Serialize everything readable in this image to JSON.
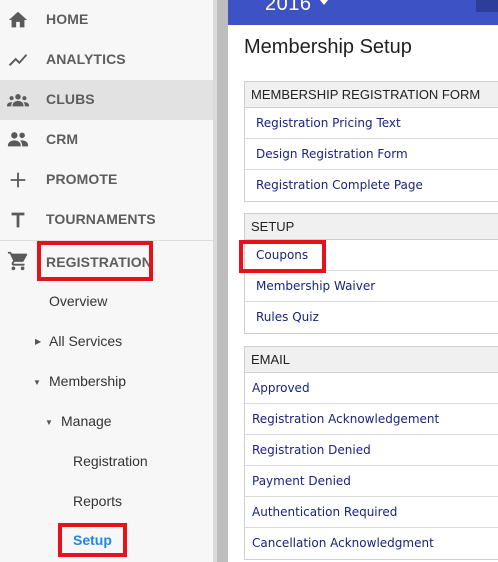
{
  "sidebar": {
    "items": [
      {
        "label": "HOME",
        "icon": "home-icon"
      },
      {
        "label": "ANALYTICS",
        "icon": "trending-line-icon"
      },
      {
        "label": "CLUBS",
        "icon": "group-icon"
      },
      {
        "label": "CRM",
        "icon": "people-icon"
      },
      {
        "label": "PROMOTE",
        "icon": "plus-icon"
      },
      {
        "label": "TOURNAMENTS",
        "icon": "letter-t-icon"
      },
      {
        "label": "REGISTRATION",
        "icon": "cart-icon"
      }
    ],
    "sub": {
      "overview": "Overview",
      "all_services": "All Services",
      "membership": "Membership",
      "manage": "Manage",
      "registration": "Registration",
      "reports": "Reports",
      "setup": "Setup"
    }
  },
  "topbar": {
    "year": "2016"
  },
  "page": {
    "title": "Membership Setup"
  },
  "sections": {
    "form": {
      "header": "MEMBERSHIP REGISTRATION FORM",
      "rows": [
        "Registration Pricing Text",
        "Design Registration Form",
        "Registration Complete Page"
      ]
    },
    "setup": {
      "header": "SETUP",
      "rows": [
        "Coupons",
        "Membership Waiver",
        "Rules Quiz"
      ]
    },
    "email": {
      "header": "EMAIL",
      "rows": [
        "Approved",
        "Registration Acknowledgement",
        "Registration Denied",
        "Payment Denied",
        "Authentication Required",
        "Cancellation Acknowledgment"
      ]
    }
  },
  "colors": {
    "topbar": "#3d52c5",
    "highlight_box": "#e5121d",
    "link": "#1a237e",
    "active_sub": "#1e88e5"
  }
}
